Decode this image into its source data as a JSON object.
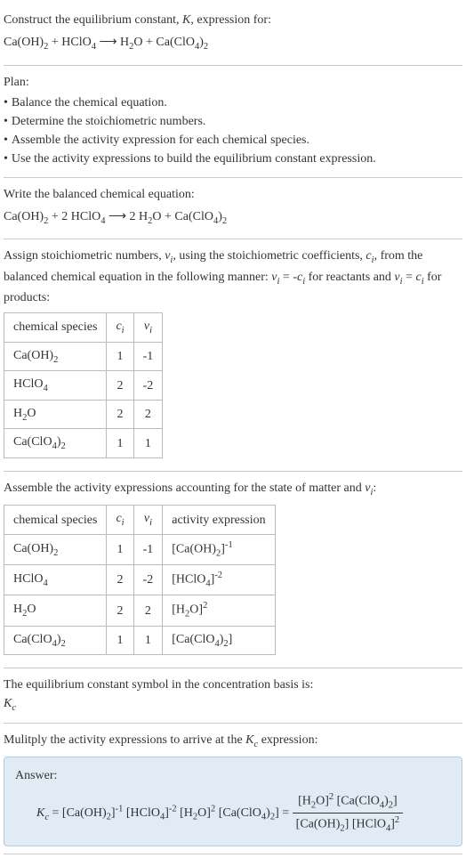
{
  "intro": {
    "line1": "Construct the equilibrium constant, K, expression for:",
    "equation": "Ca(OH)₂ + HClO₄ ⟶ H₂O + Ca(ClO₄)₂"
  },
  "plan": {
    "heading": "Plan:",
    "items": [
      "Balance the chemical equation.",
      "Determine the stoichiometric numbers.",
      "Assemble the activity expression for each chemical species.",
      "Use the activity expressions to build the equilibrium constant expression."
    ]
  },
  "balanced": {
    "heading": "Write the balanced chemical equation:",
    "equation": "Ca(OH)₂ + 2 HClO₄ ⟶ 2 H₂O + Ca(ClO₄)₂"
  },
  "stoich": {
    "text1": "Assign stoichiometric numbers, ",
    "text2": ", using the stoichiometric coefficients, ",
    "text3": ", from the balanced chemical equation in the following manner: ",
    "text4": " for reactants and ",
    "text5": " for products:",
    "headers": [
      "chemical species",
      "cᵢ",
      "νᵢ"
    ],
    "rows": [
      {
        "species": "Ca(OH)₂",
        "ci": "1",
        "vi": "-1"
      },
      {
        "species": "HClO₄",
        "ci": "2",
        "vi": "-2"
      },
      {
        "species": "H₂O",
        "ci": "2",
        "vi": "2"
      },
      {
        "species": "Ca(ClO₄)₂",
        "ci": "1",
        "vi": "1"
      }
    ]
  },
  "activity": {
    "heading": "Assemble the activity expressions accounting for the state of matter and νᵢ:",
    "headers": [
      "chemical species",
      "cᵢ",
      "νᵢ",
      "activity expression"
    ],
    "rows": [
      {
        "species": "Ca(OH)₂",
        "ci": "1",
        "vi": "-1",
        "expr": "[Ca(OH)₂]⁻¹"
      },
      {
        "species": "HClO₄",
        "ci": "2",
        "vi": "-2",
        "expr": "[HClO₄]⁻²"
      },
      {
        "species": "H₂O",
        "ci": "2",
        "vi": "2",
        "expr": "[H₂O]²"
      },
      {
        "species": "Ca(ClO₄)₂",
        "ci": "1",
        "vi": "1",
        "expr": "[Ca(ClO₄)₂]"
      }
    ]
  },
  "symbol": {
    "heading": "The equilibrium constant symbol in the concentration basis is:",
    "value": "K_c"
  },
  "multiply": {
    "heading": "Mulitply the activity expressions to arrive at the K_c expression:"
  },
  "answer": {
    "label": "Answer:",
    "lhs": "K_c = [Ca(OH)₂]⁻¹ [HClO₄]⁻² [H₂O]² [Ca(ClO₄)₂] = ",
    "numerator": "[H₂O]² [Ca(ClO₄)₂]",
    "denominator": "[Ca(OH)₂] [HClO₄]²"
  }
}
